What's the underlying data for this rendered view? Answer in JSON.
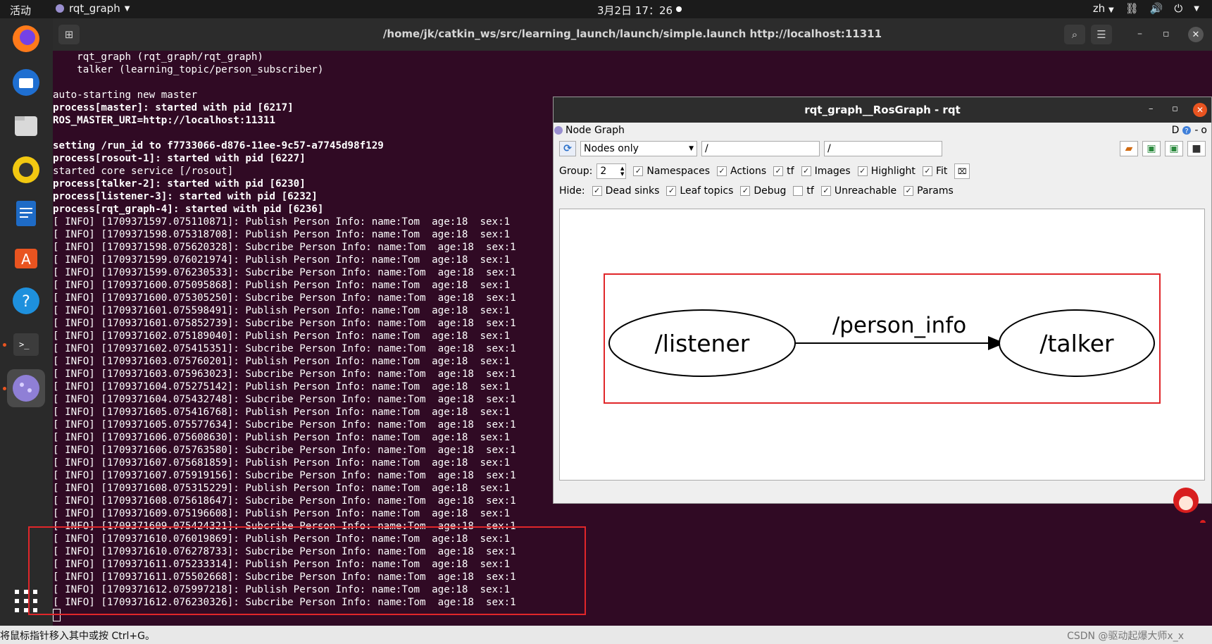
{
  "topbar": {
    "activities": "活动",
    "app_name": "rqt_graph",
    "clock": "3月2日  17：26",
    "lang": "zh"
  },
  "terminal": {
    "title": "/home/jk/catkin_ws/src/learning_launch/launch/simple.launch http://localhost:11311",
    "lines": [
      {
        "text": "    rqt_graph (rqt_graph/rqt_graph)",
        "bold": false
      },
      {
        "text": "    talker (learning_topic/person_subscriber)",
        "bold": false
      },
      {
        "text": "",
        "bold": false
      },
      {
        "text": "auto-starting new master",
        "bold": false
      },
      {
        "text": "process[master]: started with pid [6217]",
        "bold": true
      },
      {
        "text": "ROS_MASTER_URI=http://localhost:11311",
        "bold": true
      },
      {
        "text": "",
        "bold": false
      },
      {
        "text": "setting /run_id to f7733066-d876-11ee-9c57-a7745d98f129",
        "bold": true
      },
      {
        "text": "process[rosout-1]: started with pid [6227]",
        "bold": true
      },
      {
        "text": "started core service [/rosout]",
        "bold": false
      },
      {
        "text": "process[talker-2]: started with pid [6230]",
        "bold": true
      },
      {
        "text": "process[listener-3]: started with pid [6232]",
        "bold": true
      },
      {
        "text": "process[rqt_graph-4]: started with pid [6236]",
        "bold": true
      },
      {
        "text": "[ INFO] [1709371597.075110871]: Publish Person Info: name:Tom  age:18  sex:1",
        "bold": false
      },
      {
        "text": "[ INFO] [1709371598.075318708]: Publish Person Info: name:Tom  age:18  sex:1",
        "bold": false
      },
      {
        "text": "[ INFO] [1709371598.075620328]: Subcribe Person Info: name:Tom  age:18  sex:1",
        "bold": false
      },
      {
        "text": "[ INFO] [1709371599.076021974]: Publish Person Info: name:Tom  age:18  sex:1",
        "bold": false
      },
      {
        "text": "[ INFO] [1709371599.076230533]: Subcribe Person Info: name:Tom  age:18  sex:1",
        "bold": false
      },
      {
        "text": "[ INFO] [1709371600.075095868]: Publish Person Info: name:Tom  age:18  sex:1",
        "bold": false
      },
      {
        "text": "[ INFO] [1709371600.075305250]: Subcribe Person Info: name:Tom  age:18  sex:1",
        "bold": false
      },
      {
        "text": "[ INFO] [1709371601.075598491]: Publish Person Info: name:Tom  age:18  sex:1",
        "bold": false
      },
      {
        "text": "[ INFO] [1709371601.075852739]: Subcribe Person Info: name:Tom  age:18  sex:1",
        "bold": false
      },
      {
        "text": "[ INFO] [1709371602.075189040]: Publish Person Info: name:Tom  age:18  sex:1",
        "bold": false
      },
      {
        "text": "[ INFO] [1709371602.075415351]: Subcribe Person Info: name:Tom  age:18  sex:1",
        "bold": false
      },
      {
        "text": "[ INFO] [1709371603.075760201]: Publish Person Info: name:Tom  age:18  sex:1",
        "bold": false
      },
      {
        "text": "[ INFO] [1709371603.075963023]: Subcribe Person Info: name:Tom  age:18  sex:1",
        "bold": false
      },
      {
        "text": "[ INFO] [1709371604.075275142]: Publish Person Info: name:Tom  age:18  sex:1",
        "bold": false
      },
      {
        "text": "[ INFO] [1709371604.075432748]: Subcribe Person Info: name:Tom  age:18  sex:1",
        "bold": false
      },
      {
        "text": "[ INFO] [1709371605.075416768]: Publish Person Info: name:Tom  age:18  sex:1",
        "bold": false
      },
      {
        "text": "[ INFO] [1709371605.075577634]: Subcribe Person Info: name:Tom  age:18  sex:1",
        "bold": false
      },
      {
        "text": "[ INFO] [1709371606.075608630]: Publish Person Info: name:Tom  age:18  sex:1",
        "bold": false
      },
      {
        "text": "[ INFO] [1709371606.075763580]: Subcribe Person Info: name:Tom  age:18  sex:1",
        "bold": false
      },
      {
        "text": "[ INFO] [1709371607.075681859]: Publish Person Info: name:Tom  age:18  sex:1",
        "bold": false
      },
      {
        "text": "[ INFO] [1709371607.075919156]: Subcribe Person Info: name:Tom  age:18  sex:1",
        "bold": false
      },
      {
        "text": "[ INFO] [1709371608.075315229]: Publish Person Info: name:Tom  age:18  sex:1",
        "bold": false
      },
      {
        "text": "[ INFO] [1709371608.075618647]: Subcribe Person Info: name:Tom  age:18  sex:1",
        "bold": false
      },
      {
        "text": "[ INFO] [1709371609.075196608]: Publish Person Info: name:Tom  age:18  sex:1",
        "bold": false
      },
      {
        "text": "[ INFO] [1709371609.075424321]: Subcribe Person Info: name:Tom  age:18  sex:1",
        "bold": false
      },
      {
        "text": "[ INFO] [1709371610.076019869]: Publish Person Info: name:Tom  age:18  sex:1",
        "bold": false
      },
      {
        "text": "[ INFO] [1709371610.076278733]: Subcribe Person Info: name:Tom  age:18  sex:1",
        "bold": false
      },
      {
        "text": "[ INFO] [1709371611.075233314]: Publish Person Info: name:Tom  age:18  sex:1",
        "bold": false
      },
      {
        "text": "[ INFO] [1709371611.075502668]: Subcribe Person Info: name:Tom  age:18  sex:1",
        "bold": false
      },
      {
        "text": "[ INFO] [1709371612.075997218]: Publish Person Info: name:Tom  age:18  sex:1",
        "bold": false
      },
      {
        "text": "[ INFO] [1709371612.076230326]: Subcribe Person Info: name:Tom  age:18  sex:1",
        "bold": false
      }
    ]
  },
  "rqt": {
    "title": "rqt_graph__RosGraph - rqt",
    "plugin_title": "Node Graph",
    "plugin_controls": "D",
    "mode_select": "Nodes only",
    "filter1": "/",
    "filter2": "/",
    "group_label": "Group:",
    "group_value": "2",
    "options": [
      {
        "label": "Namespaces",
        "checked": true
      },
      {
        "label": "Actions",
        "checked": true
      },
      {
        "label": "tf",
        "checked": true
      },
      {
        "label": "Images",
        "checked": true
      },
      {
        "label": "Highlight",
        "checked": true
      },
      {
        "label": "Fit",
        "checked": true
      }
    ],
    "hide_label": "Hide:",
    "hide_options": [
      {
        "label": "Dead sinks",
        "checked": true
      },
      {
        "label": "Leaf topics",
        "checked": true
      },
      {
        "label": "Debug",
        "checked": true
      },
      {
        "label": "tf",
        "checked": false
      },
      {
        "label": "Unreachable",
        "checked": true
      },
      {
        "label": "Params",
        "checked": true
      }
    ],
    "graph": {
      "source_node": "/listener",
      "topic": "/person_info",
      "target_node": "/talker"
    }
  },
  "statusbar": {
    "message": "将鼠标指针移入其中或按 Ctrl+G。",
    "watermark": "CSDN @驱动起爆大师x_x"
  },
  "colors": {
    "terminal_bg": "#300a24",
    "highlight_box": "#e0262a",
    "accent": "#e95420"
  }
}
